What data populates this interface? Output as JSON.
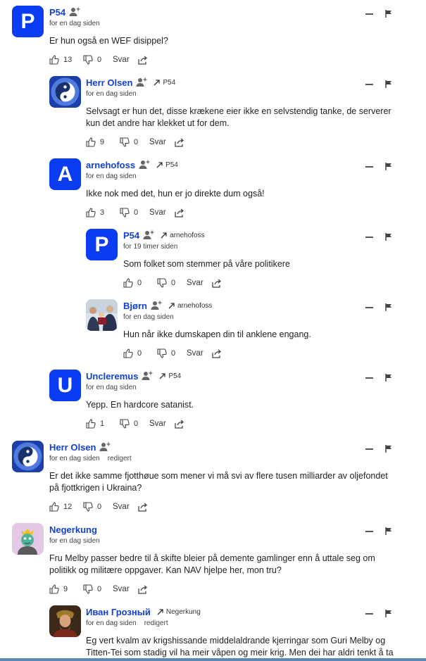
{
  "comments": [
    {
      "name": "P54",
      "avatar_letter": "P",
      "time": "for en dag siden",
      "edited": "",
      "reply_to": "",
      "text": "Er hun også en WEF disippel?",
      "likes": "13",
      "dislikes": "0",
      "reply_label": "Svar"
    },
    {
      "name": "Herr Olsen",
      "avatar_letter": "",
      "avatar_icon": "yin-yang-icon",
      "time": "for en dag siden",
      "edited": "",
      "reply_to": "P54",
      "text": "Selvsagt er hun det, disse krækene eier ikke en selvstendig tanke, de serverer kun det andre har klekket ut for dem.",
      "likes": "9",
      "dislikes": "0",
      "reply_label": "Svar"
    },
    {
      "name": "arnehofoss",
      "avatar_letter": "A",
      "time": "for en dag siden",
      "edited": "",
      "reply_to": "P54",
      "text": "Ikke nok med det, hun er jo direkte dum også!",
      "likes": "3",
      "dislikes": "0",
      "reply_label": "Svar"
    },
    {
      "name": "P54",
      "avatar_letter": "P",
      "time": "for 19 timer siden",
      "edited": "",
      "reply_to": "arnehofoss",
      "text": "Som folket som stemmer på våre politikere",
      "likes": "0",
      "dislikes": "0",
      "reply_label": "Svar"
    },
    {
      "name": "Bjørn",
      "avatar_letter": "",
      "avatar_icon": "people-photo-icon",
      "time": "for en dag siden",
      "edited": "",
      "reply_to": "arnehofoss",
      "text": "Hun når ikke dumskapen din til anklene engang.",
      "likes": "0",
      "dislikes": "0",
      "reply_label": "Svar"
    },
    {
      "name": "Uncleremus",
      "avatar_letter": "U",
      "time": "for en dag siden",
      "edited": "",
      "reply_to": "P54",
      "text": "Yepp. En hardcore satanist.",
      "likes": "1",
      "dislikes": "0",
      "reply_label": "Svar"
    },
    {
      "name": "Herr Olsen",
      "avatar_letter": "",
      "avatar_icon": "yin-yang-icon",
      "time": "for en dag siden",
      "edited": "redigert",
      "reply_to": "",
      "text": "Er det ikke samme fjotthøue som mener vi må svi av flere tusen milliarder av oljefondet på fjottkrigen i Ukraina?",
      "likes": "12",
      "dislikes": "0",
      "reply_label": "Svar"
    },
    {
      "name": "Negerkung",
      "avatar_letter": "",
      "avatar_icon": "cartoon-king-icon",
      "time": "for en dag siden",
      "edited": "",
      "reply_to": "",
      "text": "Fru Melby passer bedre til å skifte bleier på demente gamlinger enn å uttale seg om politikk og militære oppgaver. Kan NAV hjelpe her, mon tru?",
      "likes": "9",
      "dislikes": "0",
      "reply_label": "Svar"
    },
    {
      "name": "Иван Грозный",
      "avatar_letter": "",
      "avatar_icon": "portrait-icon",
      "time": "for en dag siden",
      "edited": "redigert",
      "reply_to": "Negerkung",
      "text": "Eg vert kvalm av krigshissande middelaldrande kjerringar som Guri Melby og Titten-Tei som stadig vil ha meir våpen og meir krig. Men dei har aldri tenkt å ta",
      "likes": "",
      "dislikes": "",
      "reply_label": ""
    }
  ],
  "colors": {
    "name": "#1240d6",
    "avatar_bg": "#0a3cf2",
    "bottom_bar": "#5a8bb4"
  }
}
